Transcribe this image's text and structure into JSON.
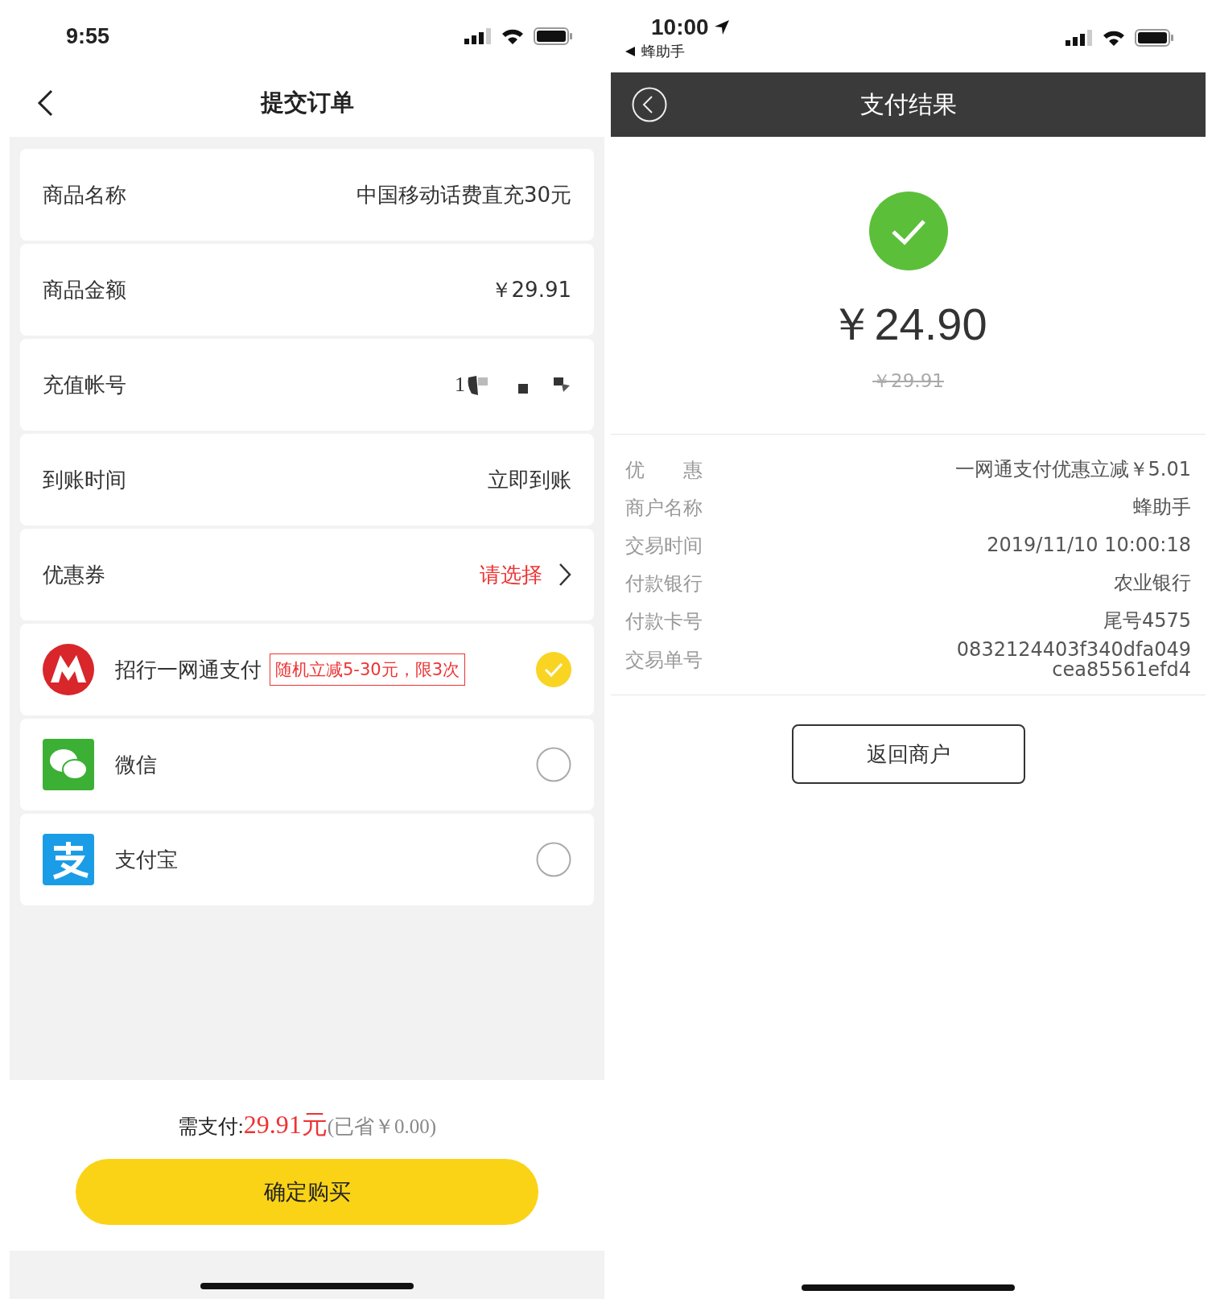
{
  "left": {
    "status_time": "9:55",
    "title": "提交订单",
    "rows": [
      {
        "kind": "text",
        "label": "商品名称",
        "value": "中国移动话费直充30元"
      },
      {
        "kind": "text",
        "label": "商品金额",
        "value": "￥29.91"
      },
      {
        "kind": "redacted",
        "label": "充值帐号",
        "value": "1"
      },
      {
        "kind": "text",
        "label": "到账时间",
        "value": "立即到账"
      },
      {
        "kind": "link",
        "label": "优惠券",
        "value": "请选择"
      }
    ],
    "payments": [
      {
        "kind": "metro",
        "name": "招行一网通支付",
        "badge": "随机立减5-30元，限3次",
        "selected": true
      },
      {
        "kind": "chat",
        "name": "微信",
        "selected": false
      },
      {
        "kind": "pay",
        "name": "支付宝",
        "selected": false
      }
    ],
    "total": {
      "label": "需支付:",
      "amount": "29.91元",
      "saved": "(已省￥0.00)"
    },
    "button": "确定购买"
  },
  "right": {
    "status_time": "10:00",
    "back_app": "蜂助手",
    "title": "支付结果",
    "amount": "￥24.90",
    "original": "￥29.91",
    "details": [
      {
        "label": "优　　惠",
        "value": "一网通支付优惠立减￥5.01"
      },
      {
        "label": "商户名称",
        "value": "蜂助手"
      },
      {
        "label": "交易时间",
        "value": "2019/11/10 10:00:18"
      },
      {
        "label": "付款银行",
        "value": "农业银行"
      },
      {
        "label": "付款卡号",
        "value": "尾号4575"
      },
      {
        "label": "交易单号",
        "value": "0832124403f340dfa049\ncea85561efd4"
      }
    ],
    "button": "返回商户"
  }
}
